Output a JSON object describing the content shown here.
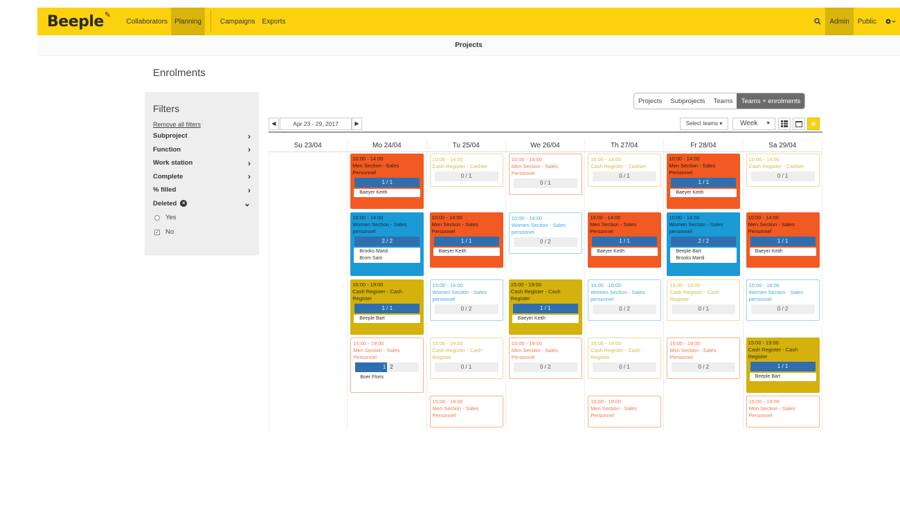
{
  "app": {
    "logo": "Beeple",
    "nav": [
      "Collaborators",
      "Planning",
      "Campaigns",
      "Exports"
    ],
    "right": {
      "admin": "Admin",
      "public": "Public"
    },
    "accent": "#fcd20f"
  },
  "subheader": "Projects",
  "page_title": "Enrolments",
  "filters": {
    "title": "Filters",
    "remove": "Remove all filters",
    "items": [
      "Subproject",
      "Function",
      "Work station",
      "Complete",
      "% filled"
    ],
    "deleted": "Deleted",
    "options": [
      "Yes",
      "No"
    ]
  },
  "view_tabs": [
    "Projects",
    "Subprojects",
    "Teams",
    "Teams + enrolments"
  ],
  "toolbar": {
    "date_range": "Apr 23 - 29, 2017",
    "select_teams": "Select teams",
    "view": "Week"
  },
  "days": [
    "Su 23/04",
    "Mo 24/04",
    "Tu 25/04",
    "We 26/04",
    "Th 27/04",
    "Fr 28/04",
    "Sa 29/04"
  ],
  "cards": {
    "mo": [
      {
        "time": "10:00 - 14:00",
        "title": "Men Section - Sales Personnel",
        "slot": "1 / 1",
        "people": [
          "Baeyer Keith"
        ]
      },
      {
        "time": "10:00 - 14:00",
        "title": "Women Section - Sales personnel",
        "slot": "2 / 2",
        "people": [
          "Brooks Mardi",
          "Brom Sam"
        ]
      },
      {
        "time": "15:00 - 19:00",
        "title": "Cash Register - Cash Register",
        "slot": "1 / 1",
        "people": [
          "Beeple Bart"
        ]
      },
      {
        "time": "15:00 - 19:00",
        "title": "Men Section - Sales Personnel",
        "slot_a": "1",
        "slot_b": "2",
        "people": [
          "Boer Floris"
        ]
      }
    ],
    "tu": [
      {
        "time": "10:00 - 14:00",
        "title": "Cash Register - Cashier",
        "slot": "0 / 1"
      },
      {
        "time": "10:00 - 14:00",
        "title": "Men Section - Sales Personnel",
        "slot": "1 / 1",
        "people": [
          "Baeyer Keith"
        ]
      },
      {
        "time": "15:00 - 16:00",
        "title": "Women Section - Sales personnel",
        "slot": "0 / 2"
      },
      {
        "time": "15:00 - 19:00",
        "title": "Cash Register - Cash Register",
        "slot": "0 / 1"
      },
      {
        "time": "15:00 - 19:00",
        "title": "Men Section - Sales Personnel"
      }
    ],
    "we": [
      {
        "time": "10:00 - 14:00",
        "title": "Men Section - Sales Personnel",
        "slot": "0 / 1"
      },
      {
        "time": "10:00 - 14:00",
        "title": "Women Section - Sales personnel",
        "slot": "0 / 2"
      },
      {
        "time": "15:00 - 19:00",
        "title": "Cash Register - Cash Register",
        "slot": "1 / 1",
        "people": [
          "Baeyer Keith"
        ]
      },
      {
        "time": "15:00 - 19:00",
        "title": "Men Section - Sales Personnel",
        "slot": "0 / 2"
      }
    ],
    "th": [
      {
        "time": "10:00 - 14:00",
        "title": "Cash Register - Cashier",
        "slot": "0 / 1"
      },
      {
        "time": "10:00 - 14:00",
        "title": "Men Section - Sales Personnel",
        "slot": "1 / 1",
        "people": [
          "Baeyer Keith"
        ]
      },
      {
        "time": "15:00 - 16:00",
        "title": "Women Section - Sales personnel",
        "slot": "0 / 2"
      },
      {
        "time": "15:00 - 19:00",
        "title": "Cash Register - Cash Register",
        "slot": "0 / 1"
      },
      {
        "time": "15:00 - 19:00",
        "title": "Men Section - Sales Personnel"
      }
    ],
    "fr": [
      {
        "time": "10:00 - 14:00",
        "title": "Men Section - Sales Personnel",
        "slot": "1 / 1",
        "people": [
          "Baeyer Keith"
        ]
      },
      {
        "time": "10:00 - 14:00",
        "title": "Women Section - Sales personnel",
        "slot": "2 / 2",
        "people": [
          "Beeple Bart",
          "Brooks Mardi"
        ]
      },
      {
        "time": "15:00 - 19:00",
        "title": "Cash Register - Cash Register",
        "slot": "0 / 1"
      },
      {
        "time": "15:00 - 19:00",
        "title": "Men Section - Sales Personnel",
        "slot": "0 / 2"
      }
    ],
    "sa": [
      {
        "time": "10:00 - 14:00",
        "title": "Cash Register - Cashier",
        "slot": "0 / 1"
      },
      {
        "time": "10:00 - 14:00",
        "title": "Men Section - Sales Personnel",
        "slot": "1 / 1",
        "people": [
          "Baeyer Keith"
        ]
      },
      {
        "time": "15:00 - 16:00",
        "title": "Women Section - Sales personnel",
        "slot": "0 / 2"
      },
      {
        "time": "15:00 - 19:00",
        "title": "Cash Register - Cash Register",
        "slot": "1 / 1",
        "people": [
          "Beeple Bart"
        ]
      },
      {
        "time": "15:00 - 19:00",
        "title": "Men Section - Sales Personnel"
      }
    ]
  }
}
